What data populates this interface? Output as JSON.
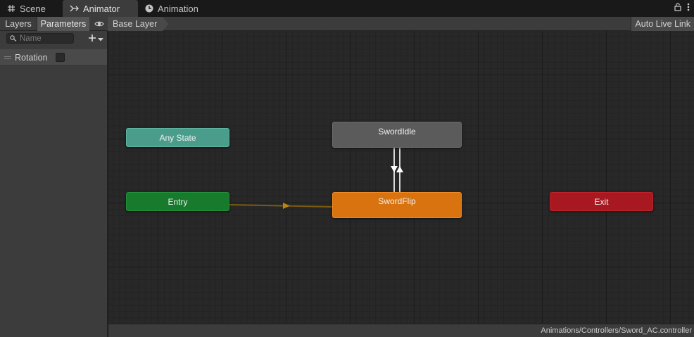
{
  "tabs": [
    {
      "label": "Scene",
      "icon": "grid-icon"
    },
    {
      "label": "Animator",
      "icon": "animator-icon",
      "active": true
    },
    {
      "label": "Animation",
      "icon": "clock-icon"
    }
  ],
  "toolbar": {
    "layers_label": "Layers",
    "parameters_label": "Parameters",
    "breadcrumb": "Base Layer",
    "live_link_label": "Auto Live Link"
  },
  "left_panel": {
    "search_placeholder": "Name",
    "parameters": [
      {
        "name": "Rotation",
        "type": "bool",
        "value": false
      }
    ]
  },
  "graph": {
    "nodes": {
      "any_state": "Any State",
      "entry": "Entry",
      "idle": "SwordIdle",
      "flip": "SwordFlip",
      "exit": "Exit"
    }
  },
  "status_bar": {
    "path": "Animations/Controllers/Sword_AC.controller"
  },
  "colors": {
    "any_state": "#4a9d8b",
    "entry": "#177a2d",
    "exit": "#a71820",
    "default_state": "#d9730f",
    "state": "#5b5b5b",
    "transition_entry": "#7a5a10"
  }
}
